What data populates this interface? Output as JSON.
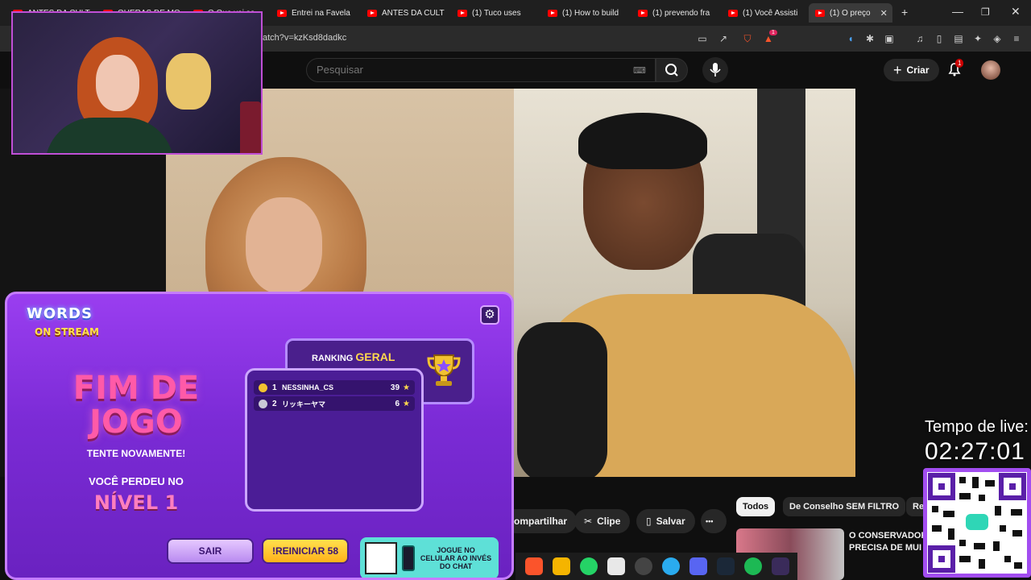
{
  "browser": {
    "tabs": [
      {
        "label": "ANTES DA CULT",
        "active": false
      },
      {
        "label": "QUERAS DE MO",
        "active": false
      },
      {
        "label": "O Que vai se",
        "active": false
      },
      {
        "label": "Entrei na Favela",
        "active": false
      },
      {
        "label": "ANTES DA CULT",
        "active": false
      },
      {
        "label": "(1) Tuco uses",
        "active": false
      },
      {
        "label": "(1) How to build",
        "active": false
      },
      {
        "label": "(1) prevendo fra",
        "active": false
      },
      {
        "label": "(1) Você Assisti",
        "active": false
      },
      {
        "label": "(1) O preço",
        "active": true
      }
    ],
    "new_tab": "+",
    "close_tab": "✕",
    "window_controls": [
      "—",
      "❐",
      "✕"
    ],
    "url": "atch?v=kzKsd8dadkc",
    "shield_badge": "1"
  },
  "youtube": {
    "search_placeholder": "Pesquisar",
    "create_label": "Criar",
    "notifications_count": "1",
    "actions": {
      "share": "ompartilhar",
      "clip": "Clipe",
      "save": "Salvar",
      "more": "•••"
    },
    "chips": [
      {
        "label": "Todos",
        "active": true
      },
      {
        "label": "De Conselho SEM FILTRO",
        "active": false
      },
      {
        "label": "Re",
        "active": false
      }
    ],
    "recommendation": {
      "title_line1": "O CONSERVADOR",
      "title_line2": "PRECISA DE MUI"
    }
  },
  "game": {
    "logo_line1": "WORDS",
    "logo_line2": "ON STREAM",
    "settings_icon": "⚙",
    "title": "FIM DE JOGO",
    "subtitle": "TENTE NOVAMENTE!",
    "lost_text": "VOCÊ PERDEU NO",
    "level_text": "NÍVEL 1",
    "ranking_label": "RANKING",
    "ranking_type": "GERAL",
    "ranking": [
      {
        "position": "1",
        "name": "NESSINHA_CS",
        "points": "39",
        "medal": "#f2c230"
      },
      {
        "position": "2",
        "name": "リッキーヤマ",
        "points": "6",
        "medal": "#c9c9d6"
      }
    ],
    "btn_exit": "SAIR",
    "btn_restart": "!REINICIAR 58",
    "mobile_cta": "JOGUE NO CELULAR AO INVÉS DO CHAT"
  },
  "stream": {
    "timer_label": "Tempo de live:",
    "timer_value": "02:27:01"
  },
  "colors": {
    "game_purple": "#7b2bd6",
    "title_pink": "#ff5aa8",
    "restart_yellow": "#ffc21a",
    "cta_teal": "#5ee0d7",
    "yt_red": "#ff0000"
  }
}
